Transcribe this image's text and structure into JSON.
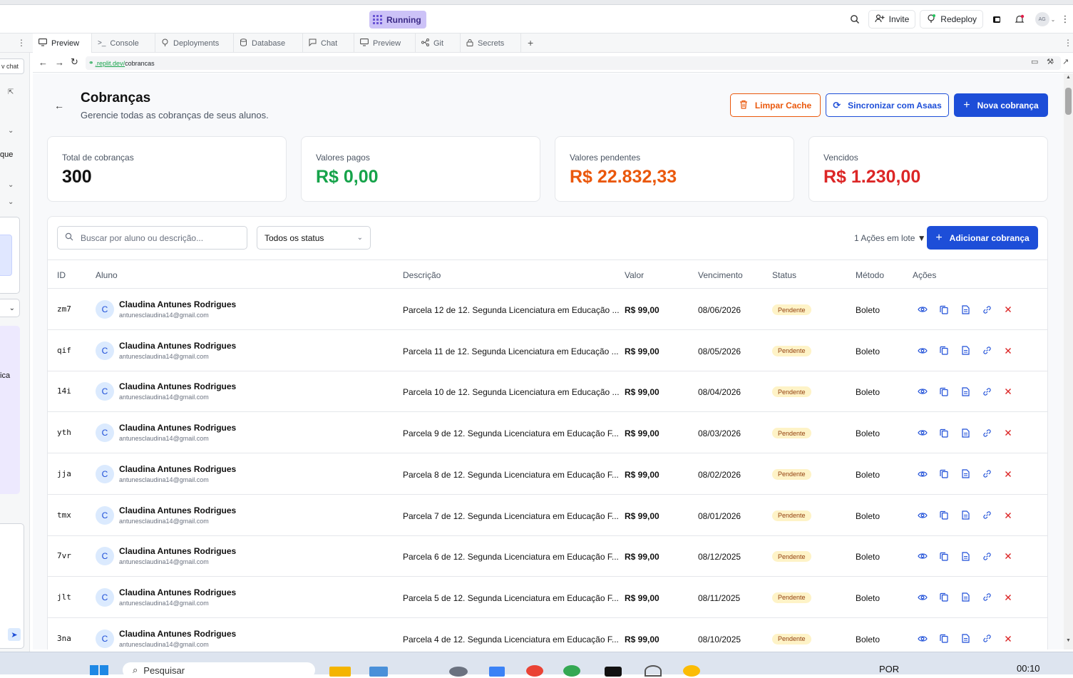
{
  "topbar": {
    "running_label": "Running",
    "invite_label": "Invite",
    "redeploy_label": "Redeploy",
    "avatar_initials": "AG"
  },
  "tabs": [
    {
      "label": "Preview",
      "active": true
    },
    {
      "label": "Console"
    },
    {
      "label": "Deployments"
    },
    {
      "label": "Database"
    },
    {
      "label": "Chat"
    },
    {
      "label": "Preview"
    },
    {
      "label": "Git"
    },
    {
      "label": "Secrets"
    }
  ],
  "url": {
    "domain": ".replit.dev/",
    "path": "cobrancas"
  },
  "leftpanel": {
    "chat_button": "v chat",
    "text_que": "que",
    "text_ica": "ica"
  },
  "page": {
    "title": "Cobranças",
    "subtitle": "Gerencie todas as cobranças de seus alunos.",
    "btn_clear_cache": "Limpar Cache",
    "btn_sync": "Sincronizar com Asaas",
    "btn_new": "Nova cobrança"
  },
  "stats": {
    "total_label": "Total de cobranças",
    "total_value": "300",
    "paid_label": "Valores pagos",
    "paid_value": "R$ 0,00",
    "pending_label": "Valores pendentes",
    "pending_value": "R$ 22.832,33",
    "overdue_label": "Vencidos",
    "overdue_value": "R$ 1.230,00",
    "colors": {
      "paid": "#16a34a",
      "pending": "#ea580c",
      "overdue": "#dc2626"
    }
  },
  "toolbar": {
    "search_placeholder": "Buscar por aluno ou descrição...",
    "status_filter": "Todos os status",
    "bulk_actions": "1 Ações em lote",
    "add_button": "Adicionar cobrança"
  },
  "table": {
    "columns": [
      "ID",
      "Aluno",
      "Descrição",
      "Valor",
      "Vencimento",
      "Status",
      "Método",
      "Ações"
    ],
    "rows": [
      {
        "id": "zm7",
        "initial": "C",
        "name": "Claudina Antunes Rodrigues",
        "email": "antunesclaudina14@gmail.com",
        "desc": "Parcela 12 de 12. Segunda Licenciatura em Educação ...",
        "valor": "R$ 99,00",
        "venc": "08/06/2026",
        "status": "Pendente",
        "metodo": "Boleto"
      },
      {
        "id": "qif",
        "initial": "C",
        "name": "Claudina Antunes Rodrigues",
        "email": "antunesclaudina14@gmail.com",
        "desc": "Parcela 11 de 12. Segunda Licenciatura em Educação ...",
        "valor": "R$ 99,00",
        "venc": "08/05/2026",
        "status": "Pendente",
        "metodo": "Boleto"
      },
      {
        "id": "14i",
        "initial": "C",
        "name": "Claudina Antunes Rodrigues",
        "email": "antunesclaudina14@gmail.com",
        "desc": "Parcela 10 de 12. Segunda Licenciatura em Educação ...",
        "valor": "R$ 99,00",
        "venc": "08/04/2026",
        "status": "Pendente",
        "metodo": "Boleto"
      },
      {
        "id": "yth",
        "initial": "C",
        "name": "Claudina Antunes Rodrigues",
        "email": "antunesclaudina14@gmail.com",
        "desc": "Parcela 9 de 12. Segunda Licenciatura em Educação F...",
        "valor": "R$ 99,00",
        "venc": "08/03/2026",
        "status": "Pendente",
        "metodo": "Boleto"
      },
      {
        "id": "jja",
        "initial": "C",
        "name": "Claudina Antunes Rodrigues",
        "email": "antunesclaudina14@gmail.com",
        "desc": "Parcela 8 de 12. Segunda Licenciatura em Educação F...",
        "valor": "R$ 99,00",
        "venc": "08/02/2026",
        "status": "Pendente",
        "metodo": "Boleto"
      },
      {
        "id": "tmx",
        "initial": "C",
        "name": "Claudina Antunes Rodrigues",
        "email": "antunesclaudina14@gmail.com",
        "desc": "Parcela 7 de 12. Segunda Licenciatura em Educação F...",
        "valor": "R$ 99,00",
        "venc": "08/01/2026",
        "status": "Pendente",
        "metodo": "Boleto"
      },
      {
        "id": "7vr",
        "initial": "C",
        "name": "Claudina Antunes Rodrigues",
        "email": "antunesclaudina14@gmail.com",
        "desc": "Parcela 6 de 12. Segunda Licenciatura em Educação F...",
        "valor": "R$ 99,00",
        "venc": "08/12/2025",
        "status": "Pendente",
        "metodo": "Boleto"
      },
      {
        "id": "jlt",
        "initial": "C",
        "name": "Claudina Antunes Rodrigues",
        "email": "antunesclaudina14@gmail.com",
        "desc": "Parcela 5 de 12. Segunda Licenciatura em Educação F...",
        "valor": "R$ 99,00",
        "venc": "08/11/2025",
        "status": "Pendente",
        "metodo": "Boleto"
      },
      {
        "id": "3na",
        "initial": "C",
        "name": "Claudina Antunes Rodrigues",
        "email": "antunesclaudina14@gmail.com",
        "desc": "Parcela 4 de 12. Segunda Licenciatura em Educação F...",
        "valor": "R$ 99,00",
        "venc": "08/10/2025",
        "status": "Pendente",
        "metodo": "Boleto"
      }
    ]
  },
  "taskbar": {
    "search_text": "Pesquisar",
    "lang": "POR",
    "time": "00:10"
  }
}
